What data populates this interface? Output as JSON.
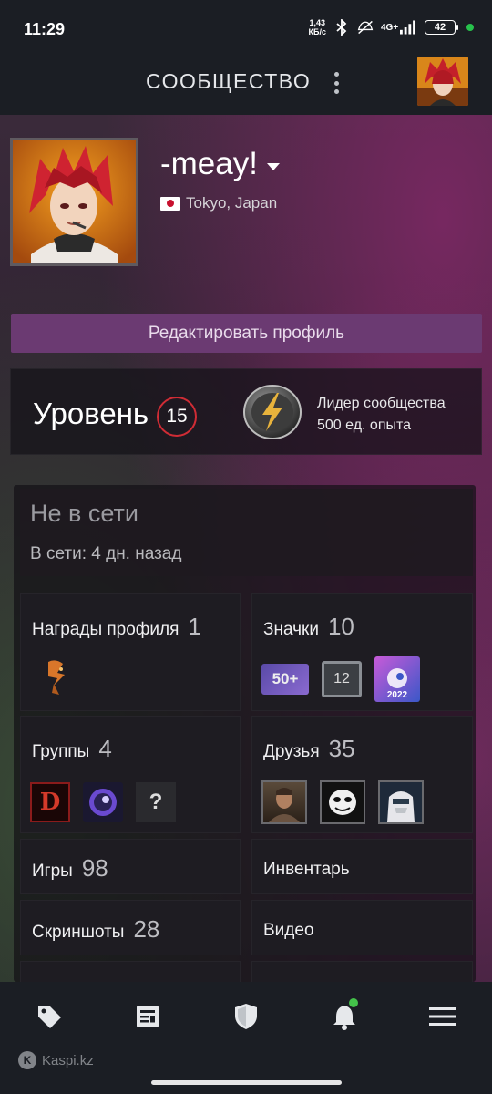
{
  "status_bar": {
    "time": "11:29",
    "net_speed_value": "1,43",
    "net_speed_unit": "КБ/с",
    "network": "4G+",
    "battery": "42",
    "icons": [
      "bluetooth-icon",
      "mute-icon",
      "signal-icon",
      "battery-icon"
    ]
  },
  "header": {
    "title": "СООБЩЕСТВО",
    "menu_icon": "kebab-menu-icon"
  },
  "profile": {
    "username": "-meay!",
    "location": "Tokyo, Japan",
    "flag": "japan-flag-icon",
    "edit_button": "Редактировать профиль"
  },
  "level": {
    "label": "Уровень",
    "value": "15",
    "badge_title": "Лидер сообщества",
    "badge_xp": "500 ед. опыта"
  },
  "status": {
    "main": "Не в сети",
    "sub": "В сети: 4 дн. назад"
  },
  "tiles": {
    "awards": {
      "label": "Награды профиля",
      "count": "1"
    },
    "badges": {
      "label": "Значки",
      "count": "10",
      "badge_50": "50+",
      "badge_12": "12",
      "badge_year": "2022"
    },
    "groups": {
      "label": "Группы",
      "count": "4",
      "group_d": "D",
      "group_unknown": "?"
    },
    "friends": {
      "label": "Друзья",
      "count": "35"
    },
    "games": {
      "label": "Игры",
      "count": "98"
    },
    "inventory": {
      "label": "Инвентарь"
    },
    "screenshots": {
      "label": "Скриншоты",
      "count": "28"
    },
    "video": {
      "label": "Видео"
    }
  },
  "bottom_nav": {
    "items": [
      "tag-icon",
      "news-icon",
      "shield-icon",
      "bell-icon",
      "hamburger-menu-icon"
    ]
  },
  "watermark": {
    "text": "Kaspi.kz",
    "logo_letter": "K"
  },
  "colors": {
    "accent": "#6b3a72",
    "level_ring": "#d02c35",
    "online_dot": "#44c24a"
  }
}
